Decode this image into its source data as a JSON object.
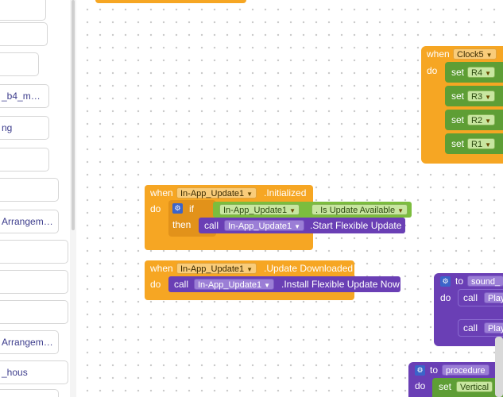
{
  "sidebar": {
    "items": [
      {
        "label": ""
      },
      {
        "label": ""
      },
      {
        "label": ""
      },
      {
        "label": "_b4_m…"
      },
      {
        "label": "ng"
      },
      {
        "label": ""
      },
      {
        "label": ""
      },
      {
        "label": "Arrangem…"
      },
      {
        "label": ""
      },
      {
        "label": ""
      },
      {
        "label": ""
      },
      {
        "label": "Arrangem…"
      },
      {
        "label": "_hous"
      },
      {
        "label": ""
      }
    ]
  },
  "blocks": {
    "clock": {
      "when": "when",
      "component": "Clock5",
      "do": "do",
      "sets": [
        {
          "set": "set",
          "target": "R4"
        },
        {
          "set": "set",
          "target": "R3"
        },
        {
          "set": "set",
          "target": "R2"
        },
        {
          "set": "set",
          "target": "R1"
        }
      ]
    },
    "initialized": {
      "when": "when",
      "component": "In-App_Update1",
      "event": ".Initialized",
      "do": "do",
      "if": "if",
      "then": "then",
      "condition_component": "In-App_Update1",
      "condition_property": "Is Update Available",
      "call": "call",
      "call_component": "In-App_Update1",
      "call_method": ".Start Flexible Update"
    },
    "downloaded": {
      "when": "when",
      "component": "In-App_Update1",
      "event": ".Update Downloaded",
      "do": "do",
      "call": "call",
      "call_component": "In-App_Update1",
      "call_method": ".Install Flexible Update Now"
    },
    "sound_proc": {
      "to": "to",
      "name": "sound_",
      "do": "do",
      "calls": [
        {
          "call": "call",
          "target": "Play"
        },
        {
          "call": "call",
          "target": "Play"
        }
      ]
    },
    "procedure": {
      "to": "to",
      "name": "procedure",
      "do": "do",
      "set": "set",
      "target": "Vertical"
    }
  },
  "colors": {
    "event_orange": "#f6a623",
    "logic_green": "#7cbd3e",
    "component_purple": "#6a3fb5",
    "procedure_purple": "#6a3fb5"
  }
}
